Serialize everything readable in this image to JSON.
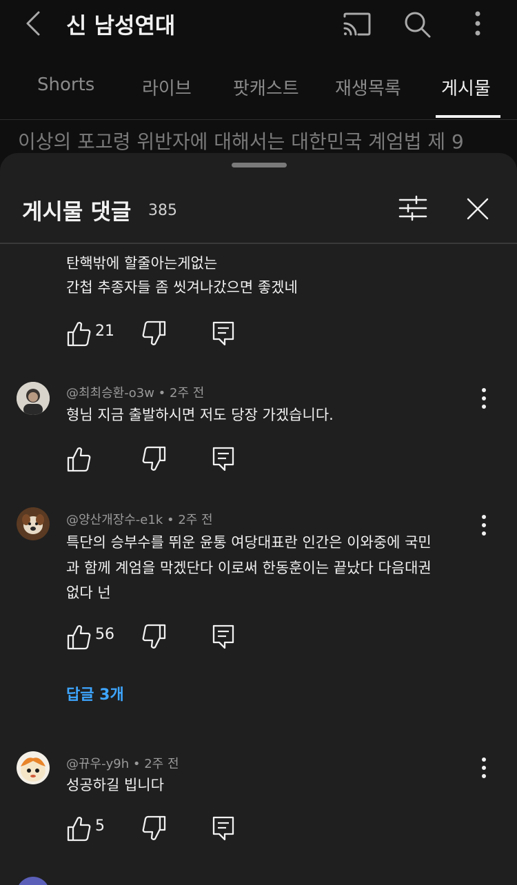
{
  "appbar": {
    "title": "신 남성연대"
  },
  "tabs": [
    {
      "label": "Shorts",
      "active": false
    },
    {
      "label": "라이브",
      "active": false
    },
    {
      "label": "팟캐스트",
      "active": false
    },
    {
      "label": "재생목록",
      "active": false
    },
    {
      "label": "게시물",
      "active": true
    }
  ],
  "background_text": "이상의 포고령 위반자에 대해서는 대한민국 계엄법 제 9",
  "sheet": {
    "title": "게시물 댓글",
    "count": "385"
  },
  "comments": [
    {
      "lines": [
        "탄핵밖에 할줄아는게없는",
        "간첩 추종자들 좀 씻겨나갔으면 좋겠네"
      ],
      "likes": "21"
    },
    {
      "author": "@최최승환-o3w",
      "time": "2주 전",
      "lines": [
        "형님 지금  출발하시면 저도 당장 가겠습니다."
      ],
      "likes": ""
    },
    {
      "author": "@양산개장수-e1k",
      "time": "2주 전",
      "lines": [
        "특단의 승부수를 뛰운 윤통  여당대표란 인간은  이와중에 국민",
        "과 함께 계엄을 막겠단다  이로써 한동훈이는  끝났다  다음대권",
        "없다 넌"
      ],
      "likes": "56",
      "replies": "답글 3개"
    },
    {
      "author": "@뀨우-y9h",
      "time": "2주 전",
      "lines": [
        "성공하길 빕니다"
      ],
      "likes": "5"
    }
  ],
  "colors": {
    "background": "#0f0f0f",
    "sheet": "#1f1f1f",
    "link": "#3ea6ff",
    "muted": "#9a9a9a"
  }
}
